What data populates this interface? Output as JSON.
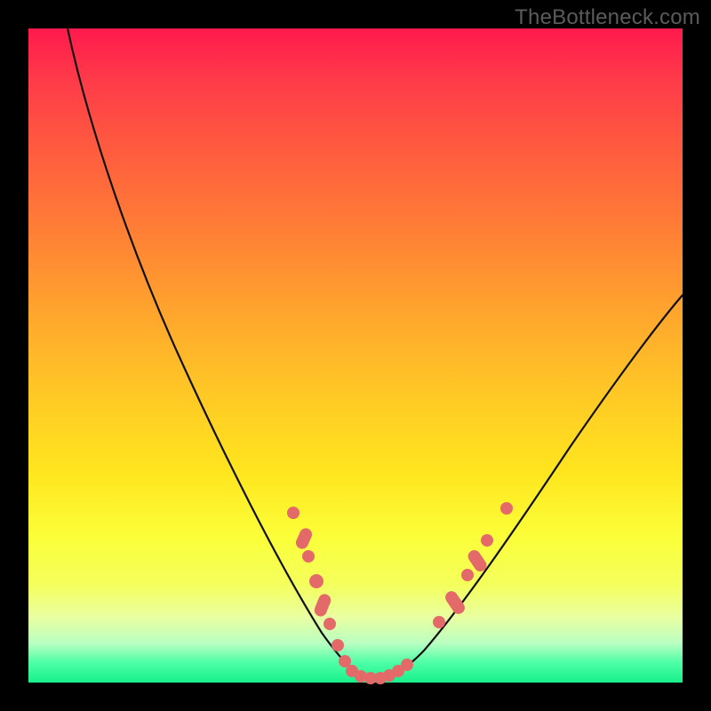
{
  "watermark": "TheBottleneck.com",
  "colors": {
    "dot": "#e46a6a",
    "curve": "#111111",
    "background_outer": "#000000"
  },
  "chart_data": {
    "type": "line",
    "title": "",
    "xlabel": "",
    "ylabel": "",
    "xlim": [
      0,
      100
    ],
    "ylim": [
      0,
      100
    ],
    "grid": false,
    "legend": false,
    "series": [
      {
        "name": "bottleneck-curve",
        "x": [
          6,
          10,
          14,
          18,
          22,
          26,
          30,
          34,
          38,
          42,
          46,
          48,
          50,
          52,
          54,
          58,
          62,
          66,
          70,
          74,
          78,
          82,
          86,
          90,
          94,
          98,
          100
        ],
        "y": [
          100,
          93,
          84,
          75,
          66,
          57,
          48,
          40,
          32,
          24,
          14,
          8,
          3,
          0,
          0,
          1,
          4,
          9,
          15,
          22,
          29,
          36,
          43,
          50,
          56,
          60,
          62
        ]
      }
    ],
    "markers": {
      "name": "highlighted-points",
      "comment": "approximate dot locations along the curve (x% of plot width, y% from bottom)",
      "points": [
        {
          "x": 40.5,
          "y": 26.0
        },
        {
          "x": 42.0,
          "y": 21.5
        },
        {
          "x": 42.8,
          "y": 19.0
        },
        {
          "x": 44.0,
          "y": 15.0
        },
        {
          "x": 44.8,
          "y": 12.0
        },
        {
          "x": 46.0,
          "y": 8.5
        },
        {
          "x": 47.2,
          "y": 5.0
        },
        {
          "x": 48.3,
          "y": 2.5
        },
        {
          "x": 49.3,
          "y": 1.2
        },
        {
          "x": 50.5,
          "y": 0.6
        },
        {
          "x": 52.0,
          "y": 0.4
        },
        {
          "x": 53.3,
          "y": 0.5
        },
        {
          "x": 54.6,
          "y": 0.8
        },
        {
          "x": 55.8,
          "y": 1.4
        },
        {
          "x": 57.0,
          "y": 2.2
        },
        {
          "x": 62.5,
          "y": 9.0
        },
        {
          "x": 65.5,
          "y": 14.0
        },
        {
          "x": 67.0,
          "y": 16.5
        },
        {
          "x": 68.5,
          "y": 19.0
        },
        {
          "x": 70.0,
          "y": 21.5
        },
        {
          "x": 73.0,
          "y": 26.5
        }
      ]
    }
  }
}
